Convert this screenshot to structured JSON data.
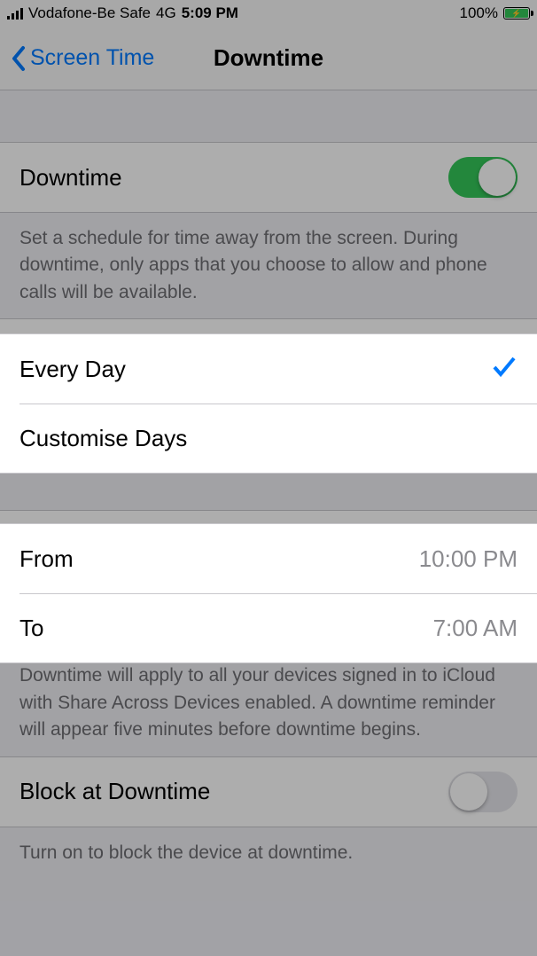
{
  "status": {
    "carrier": "Vodafone-Be Safe",
    "network": "4G",
    "time": "5:09 PM",
    "battery_pct": "100%"
  },
  "nav": {
    "back_label": "Screen Time",
    "title": "Downtime"
  },
  "downtime_toggle": {
    "label": "Downtime",
    "on": true
  },
  "downtime_description": "Set a schedule for time away from the screen. During downtime, only apps that you choose to allow and phone calls will be available.",
  "schedule_mode": {
    "every_day": {
      "label": "Every Day",
      "selected": true
    },
    "customise": {
      "label": "Customise Days",
      "selected": false
    }
  },
  "time_range": {
    "from_label": "From",
    "from_value": "10:00 PM",
    "to_label": "To",
    "to_value": "7:00 AM"
  },
  "devices_note": "Downtime will apply to all your devices signed in to iCloud with Share Across Devices enabled. A downtime reminder will appear five minutes before downtime begins.",
  "block": {
    "label": "Block at Downtime",
    "on": false,
    "note": "Turn on to block the device at downtime."
  },
  "colors": {
    "tint": "#007aff",
    "green": "#34c759"
  }
}
